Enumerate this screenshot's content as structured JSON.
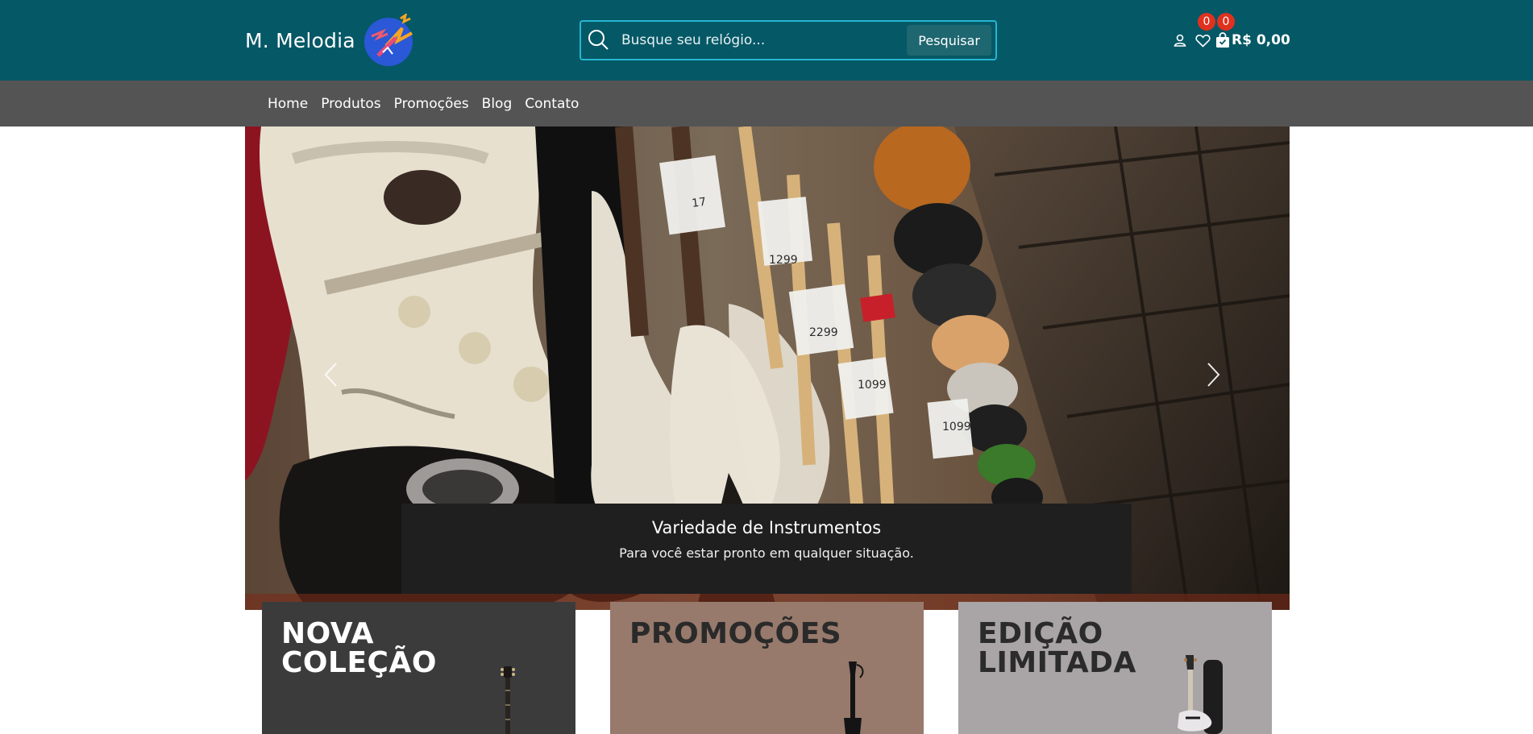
{
  "header": {
    "brand_name": "M. Melodia",
    "search_placeholder": "Busque seu relógio...",
    "search_button": "Pesquisar",
    "wishlist_count": "0",
    "cart_count": "0",
    "cart_total": "R$ 0,00"
  },
  "nav": {
    "items": [
      {
        "label": "Home"
      },
      {
        "label": "Produtos"
      },
      {
        "label": "Promoções"
      },
      {
        "label": "Blog"
      },
      {
        "label": "Contato"
      }
    ]
  },
  "hero": {
    "caption_title": "Variedade de Instrumentos",
    "caption_subtitle": "Para você estar pronto em qualquer situação."
  },
  "cards": [
    {
      "title_line1": "NOVA",
      "title_line2": "COLEÇÃO"
    },
    {
      "title_line1": "PROMOÇÕES",
      "title_line2": ""
    },
    {
      "title_line1": "EDIÇÃO",
      "title_line2": "LIMITADA"
    }
  ],
  "colors": {
    "header_bg": "#055866",
    "search_border": "#26b6cf",
    "nav_bg": "#545454",
    "badge": "#e0311f",
    "caption_bg": "#1f1f1f"
  },
  "icons": [
    "search-icon",
    "user-icon",
    "heart-icon",
    "shopping-bag-icon",
    "chevron-left-icon",
    "chevron-right-icon"
  ]
}
